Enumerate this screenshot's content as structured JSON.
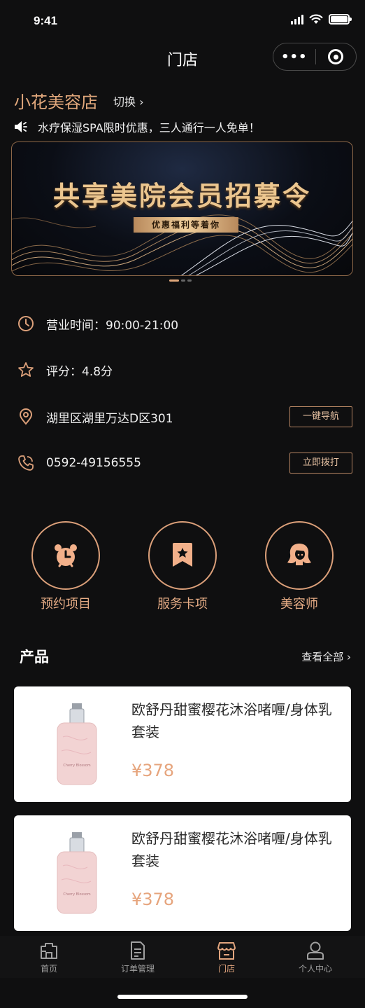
{
  "status_bar": {
    "time": "9:41"
  },
  "nav": {
    "title": "门店",
    "more_label": "•••"
  },
  "store": {
    "name": "小花美容店",
    "switch_label": "切换 ›"
  },
  "notice": {
    "text": "水疗保湿SPA限时优惠，三人通行一人免单！"
  },
  "banner": {
    "title": "共享美院会员招募令",
    "subtitle": "优惠福利等着你",
    "total_slides": 3,
    "active_slide": 1
  },
  "info": {
    "hours": "营业时间：90:00-21:00",
    "rating": "评分：4.8分",
    "address": "湖里区湖里万达D区301",
    "navigate_label": "一键导航",
    "phone": "0592-49156555",
    "call_label": "立即拨打"
  },
  "quick_actions": [
    {
      "label": "预约项目",
      "icon": "alarm-clock-icon"
    },
    {
      "label": "服务卡项",
      "icon": "bookmark-star-icon"
    },
    {
      "label": "美容师",
      "icon": "beautician-icon"
    }
  ],
  "products_section": {
    "title": "产品",
    "see_all": "查看全部 ›"
  },
  "products": [
    {
      "name": "欧舒丹甜蜜樱花沐浴啫喱/身体乳套装",
      "price": "¥378"
    },
    {
      "name": "欧舒丹甜蜜樱花沐浴啫喱/身体乳套装",
      "price": "¥378"
    }
  ],
  "tabbar": [
    {
      "label": "首页",
      "icon": "home-icon",
      "active": false
    },
    {
      "label": "订单管理",
      "icon": "order-icon",
      "active": false
    },
    {
      "label": "门店",
      "icon": "store-icon",
      "active": true
    },
    {
      "label": "个人中心",
      "icon": "user-icon",
      "active": false
    }
  ],
  "colors": {
    "accent": "#e0a77b",
    "background": "#0f0f10",
    "card": "#ffffff",
    "price": "#e6a47c"
  }
}
